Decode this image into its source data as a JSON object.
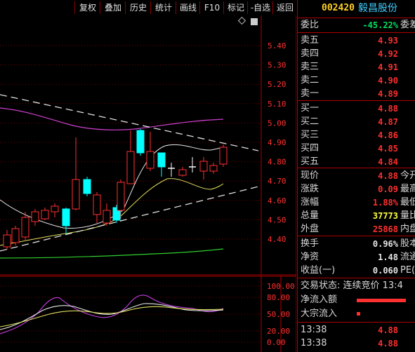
{
  "toolbar": {
    "buttons": [
      "复权",
      "叠加",
      "历史",
      "统计",
      "画线",
      "F10",
      "标记",
      "-自选",
      "返回"
    ]
  },
  "header": {
    "code": "002420",
    "name": "毅昌股份"
  },
  "colors": {
    "up": "#ff3030",
    "down": "#00ffff",
    "bg": "#000000",
    "grid": "#8b0000"
  },
  "chart": {
    "price_ticks": [
      "5.40",
      "5.30",
      "5.20",
      "5.10",
      "5.00",
      "4.90",
      "4.80",
      "4.70",
      "4.60",
      "4.50",
      "4.40"
    ],
    "indicator_ticks": [
      "100.00",
      "80.00",
      "50.00",
      "20.00",
      "0.00"
    ]
  },
  "quote": {
    "weibi_label": "委比",
    "weibi_value": "-45.22%",
    "weibi_extra": "委差",
    "asks": [
      {
        "label": "卖五",
        "price": "4.93"
      },
      {
        "label": "卖四",
        "price": "4.92"
      },
      {
        "label": "卖三",
        "price": "4.91"
      },
      {
        "label": "卖二",
        "price": "4.90"
      },
      {
        "label": "卖一",
        "price": "4.89"
      }
    ],
    "bids": [
      {
        "label": "买一",
        "price": "4.88"
      },
      {
        "label": "买二",
        "price": "4.87"
      },
      {
        "label": "买三",
        "price": "4.86"
      },
      {
        "label": "买四",
        "price": "4.85"
      },
      {
        "label": "买五",
        "price": "4.84"
      }
    ],
    "stats": [
      {
        "label": "现价",
        "value": "4.88",
        "extra": "今开"
      },
      {
        "label": "涨跌",
        "value": "0.09",
        "extra": "最高"
      },
      {
        "label": "涨幅",
        "value": "1.88%",
        "extra": "最低"
      },
      {
        "label": "总量",
        "value": "37773",
        "extra": "量比"
      },
      {
        "label": "外盘",
        "value": "25868",
        "extra": "内盘"
      }
    ],
    "stats2": [
      {
        "label": "换手",
        "value": "0.96%",
        "extra": "股本"
      },
      {
        "label": "净资",
        "value": "1.48",
        "extra": "流通"
      },
      {
        "label": "收益(一)",
        "value": "0.060",
        "extra": "PE(动)"
      }
    ]
  },
  "trade": {
    "status": "交易状态: 连续竞价 13:4",
    "flows": [
      {
        "label": "净流入额"
      },
      {
        "label": "大宗流入"
      }
    ]
  },
  "ticks": [
    {
      "time": "13:38",
      "price": "4.88"
    },
    {
      "time": "13:38",
      "price": "4.88"
    }
  ]
}
